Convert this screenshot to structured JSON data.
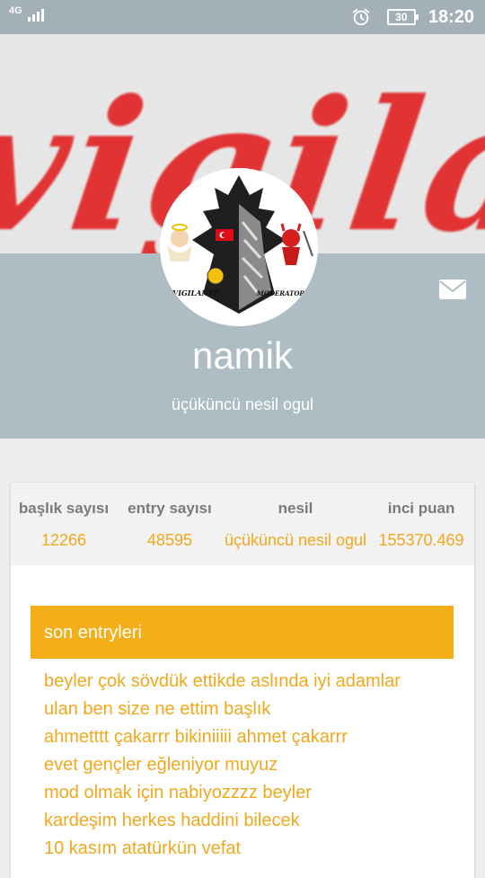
{
  "status_bar": {
    "network": "4G",
    "battery": "30",
    "time": "18:20",
    "icons": [
      "signal-icon",
      "alarm-icon",
      "battery-icon"
    ]
  },
  "banner": {
    "text": "vigilante"
  },
  "avatar": {
    "left_label": "VIGILANTE",
    "right_label": "MODERATOR"
  },
  "profile": {
    "username": "namik",
    "title": "üçüküncü nesil ogul"
  },
  "stats": [
    {
      "label": "başlık sayısı",
      "value": "12266"
    },
    {
      "label": "entry sayısı",
      "value": "48595"
    },
    {
      "label": "nesil",
      "value": "üçüküncü nesil ogul"
    },
    {
      "label": "inci puan",
      "value": "155370.469"
    }
  ],
  "recent": {
    "header": "son entryleri",
    "items": [
      "beyler çok sövdük ettikde aslında iyi adamlar",
      "ulan ben size ne ettim başlık",
      "ahmetttt çakarrr bikiniiiii ahmet çakarrr",
      "evet gençler eğleniyor muyuz",
      "mod olmak için nabiyozzzz beyler",
      "kardeşim herkes haddini bilecek",
      "10 kasım atatürkün vefat"
    ]
  },
  "colors": {
    "accent": "#f4ae17",
    "entry_text": "#f0a81c",
    "profile_bg": "#aebcc3",
    "status_bar": "#a4b0b7"
  }
}
